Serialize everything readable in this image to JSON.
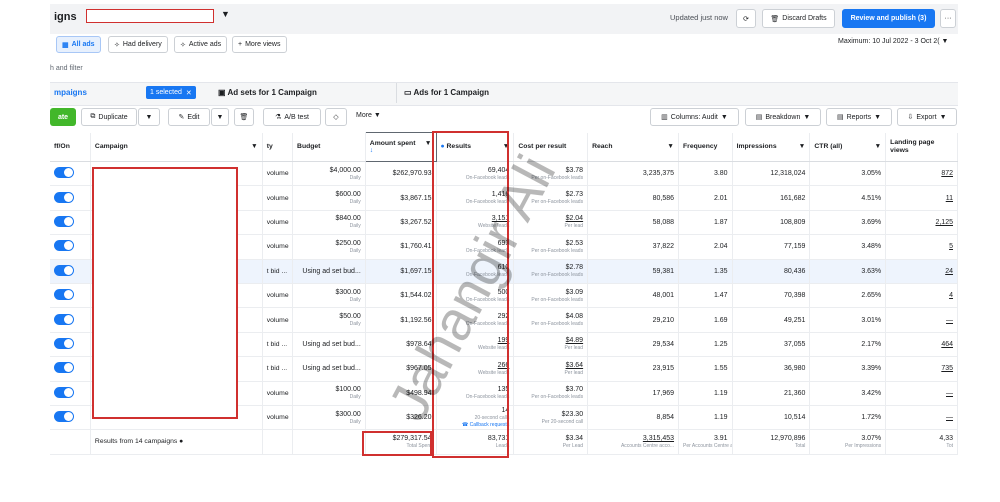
{
  "header": {
    "title": "igns",
    "updated": "Updated just now",
    "discard": "Discard Drafts",
    "publish": "Review and publish (3)",
    "more": "···"
  },
  "filters": {
    "pills": [
      "All ads",
      "Had delivery",
      "Active ads",
      "More views"
    ],
    "date_range": "Maximum: 10 Jul 2022 - 3 Oct 2(",
    "search_hint": "h and filter"
  },
  "tabs": {
    "campaigns": "mpaigns",
    "selected": "1 selected",
    "adsets": "Ad sets for 1 Campaign",
    "ads": "Ads for 1 Campaign"
  },
  "toolbar": {
    "create": "ate",
    "duplicate": "Duplicate",
    "edit": "Edit",
    "ab_test": "A/B test",
    "more": "More",
    "columns": "Columns: Audit",
    "breakdown": "Breakdown",
    "reports": "Reports",
    "export": "Export"
  },
  "columns": {
    "onoff": "ff/On",
    "campaign": "Campaign",
    "strategy": "ty",
    "budget": "Budget",
    "amount_spent": "Amount spent",
    "results": "Results",
    "cost_per_result": "Cost per result",
    "reach": "Reach",
    "frequency": "Frequency",
    "impressions": "Impressions",
    "ctr": "CTR (all)",
    "landing": "Landing page views"
  },
  "rows": [
    {
      "strategy": "volume",
      "budget": "$4,000.00",
      "budget_sub": "Daily",
      "spent": "$262,970.93",
      "results": "69,404",
      "results_sub": "On-Facebook leads",
      "cpr": "$3.78",
      "cpr_sub": "Per on-Facebook leads",
      "reach": "3,235,375",
      "freq": "3.80",
      "impr": "12,318,024",
      "ctr": "3.05%",
      "landing": "872"
    },
    {
      "strategy": "volume",
      "mid": "-24",
      "budget": "$600.00",
      "budget_sub": "Daily",
      "spent": "$3,867.15",
      "results": "1,416",
      "results_sub": "On-Facebook leads",
      "cpr": "$2.73",
      "cpr_sub": "Per on-Facebook leads",
      "reach": "80,586",
      "freq": "2.01",
      "impr": "161,682",
      "ctr": "4.51%",
      "landing": "11"
    },
    {
      "strategy": "volume",
      "mid": "y",
      "budget": "$840.00",
      "budget_sub": "Daily",
      "spent": "$3,267.52",
      "results": "3,151",
      "results_sub": "Website leads",
      "cpr": "$2.04",
      "cpr_sub": "Per lead",
      "reach": "58,088",
      "freq": "1.87",
      "impr": "108,809",
      "ctr": "3.69%",
      "landing": "2,125"
    },
    {
      "strategy": "volume",
      "budget": "$250.00",
      "budget_sub": "Daily",
      "spent": "$1,760.41",
      "results": "693",
      "results_sub": "On-Facebook leads",
      "cpr": "$2.53",
      "cpr_sub": "Per on-Facebook leads",
      "reach": "37,822",
      "freq": "2.04",
      "impr": "77,159",
      "ctr": "3.48%",
      "landing": "5"
    },
    {
      "strategy": "t bid ...",
      "mid": "-24",
      "budget": "Using ad set bud...",
      "budget_sub": "",
      "spent": "$1,697.15",
      "results": "610",
      "results_sub": "On-Facebook leads",
      "cpr": "$2.78",
      "cpr_sub": "Per on-Facebook leads",
      "reach": "59,381",
      "freq": "1.35",
      "impr": "80,436",
      "ctr": "3.63%",
      "landing": "24"
    },
    {
      "strategy": "volume",
      "budget": "$300.00",
      "budget_sub": "Daily",
      "spent": "$1,544.02",
      "results": "500",
      "results_sub": "On-Facebook leads",
      "cpr": "$3.09",
      "cpr_sub": "Per on-Facebook leads",
      "reach": "48,001",
      "freq": "1.47",
      "impr": "70,398",
      "ctr": "2.65%",
      "landing": "4"
    },
    {
      "strategy": "volume",
      "budget": "$50.00",
      "budget_sub": "Daily",
      "spent": "$1,192.56",
      "results": "292",
      "results_sub": "On-Facebook leads",
      "cpr": "$4.08",
      "cpr_sub": "Per on-Facebook leads",
      "reach": "29,210",
      "freq": "1.69",
      "impr": "49,251",
      "ctr": "3.01%",
      "landing": "—"
    },
    {
      "strategy": "t bid ...",
      "budget": "Using ad set bud...",
      "budget_sub": "",
      "spent": "$978.64",
      "results": "199",
      "results_sub": "Website leads",
      "cpr": "$4.89",
      "cpr_sub": "Per lead",
      "reach": "29,534",
      "freq": "1.25",
      "impr": "37,055",
      "ctr": "2.17%",
      "landing": "464"
    },
    {
      "strategy": "t bid ...",
      "budget": "Using ad set bud...",
      "budget_sub": "",
      "spent": "$967.05",
      "results": "266",
      "results_sub": "Website leads",
      "cpr": "$3.64",
      "cpr_sub": "Per lead",
      "reach": "23,915",
      "freq": "1.55",
      "impr": "36,980",
      "ctr": "3.39%",
      "landing": "735"
    },
    {
      "strategy": "volume",
      "budget": "$100.00",
      "budget_sub": "Daily",
      "spent": "$498.94",
      "results": "135",
      "results_sub": "On-Facebook leads",
      "cpr": "$3.70",
      "cpr_sub": "Per on-Facebook leads",
      "reach": "17,969",
      "freq": "1.19",
      "impr": "21,360",
      "ctr": "3.42%",
      "landing": "—"
    },
    {
      "strategy": "volume",
      "budget": "$300.00",
      "budget_sub": "Daily",
      "spent": "$326.20",
      "results": "14",
      "results_sub": "20-second calls",
      "results_extra": "Callback requests",
      "cpr": "$23.30",
      "cpr_sub": "Per 20-second call",
      "reach": "8,854",
      "freq": "1.19",
      "impr": "10,514",
      "ctr": "1.72%",
      "landing": "—"
    }
  ],
  "summary": {
    "label": "Results from 14 campaigns",
    "spent": "$279,317.54",
    "spent_sub": "Total Spent",
    "results": "83,731",
    "results_sub": "Leads",
    "cpr": "$3.34",
    "cpr_sub": "Per Lead",
    "reach": "3,315,453",
    "reach_sub": "Accounts Centre acco...",
    "freq": "3.91",
    "freq_sub": "Per Accounts Centre a...",
    "impr": "12,970,896",
    "impr_sub": "Total",
    "ctr": "3.07%",
    "ctr_sub": "Per Impressions",
    "landing": "4,33",
    "landing_sub": "Tot"
  },
  "watermark": "Jahangir Ali"
}
